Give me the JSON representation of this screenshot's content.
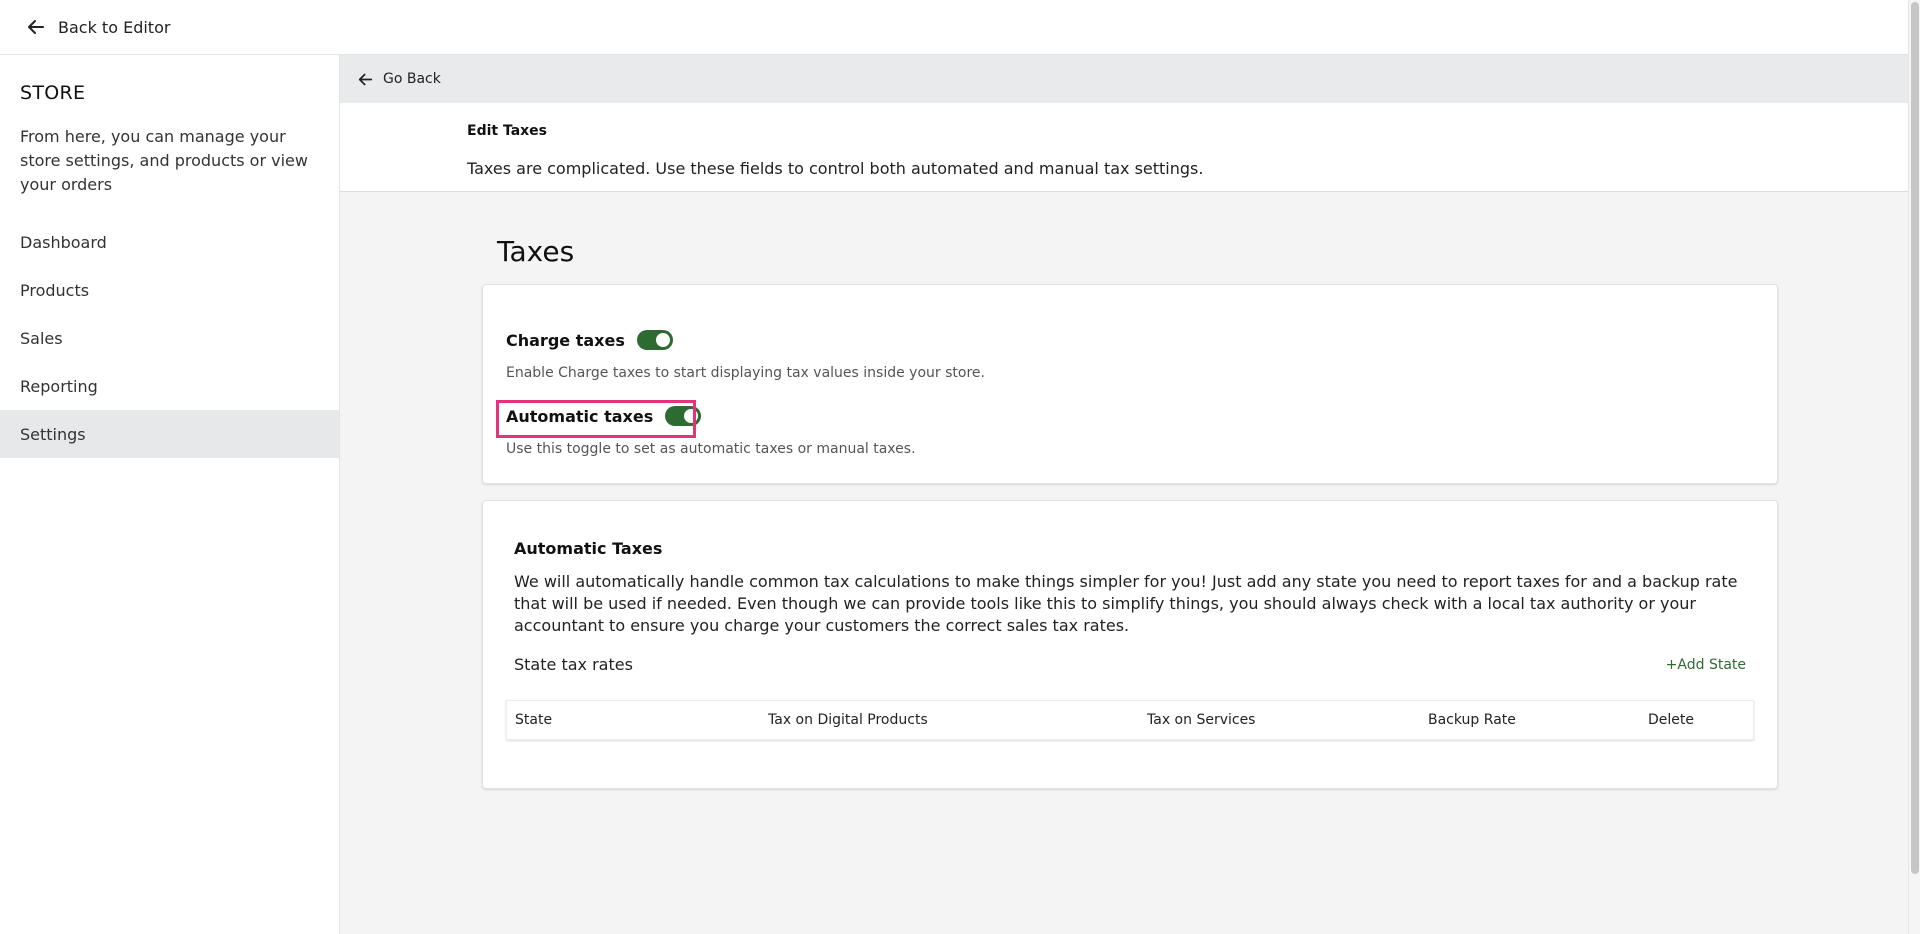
{
  "topbar": {
    "back_label": "Back to Editor"
  },
  "sidebar": {
    "title": "STORE",
    "description": "From here, you can manage your store settings, and products or view your orders",
    "items": [
      {
        "label": "Dashboard",
        "active": false
      },
      {
        "label": "Products",
        "active": false
      },
      {
        "label": "Sales",
        "active": false
      },
      {
        "label": "Reporting",
        "active": false
      },
      {
        "label": "Settings",
        "active": true
      }
    ]
  },
  "main": {
    "goback_label": "Go Back",
    "header": {
      "title": "Edit Taxes",
      "subtitle": "Taxes are complicated. Use these fields to control both automated and manual tax settings."
    },
    "heading": "Taxes",
    "charge_taxes": {
      "label": "Charge taxes",
      "enabled": true,
      "helper": "Enable Charge taxes to start displaying tax values inside your store."
    },
    "automatic_taxes": {
      "label": "Automatic taxes",
      "enabled": true,
      "helper": "Use this toggle to set as automatic taxes or manual taxes."
    },
    "automatic_section": {
      "title": "Automatic Taxes",
      "body": "We will automatically handle common tax calculations to make things simpler for you! Just add any state you need to report taxes for and a backup rate that will be used if needed. Even though we can provide tools like this to simplify things, you should always check with a local tax authority or your accountant to ensure you charge your customers the correct sales tax rates.",
      "rates_label": "State tax rates",
      "add_state_label": "+Add State",
      "columns": [
        "State",
        "Tax on Digital Products",
        "Tax on Services",
        "Backup Rate",
        "Delete"
      ]
    }
  },
  "colors": {
    "accent": "#2e6b32",
    "highlight": "#e4337a",
    "active_nav_bg": "#e7e8ea"
  }
}
